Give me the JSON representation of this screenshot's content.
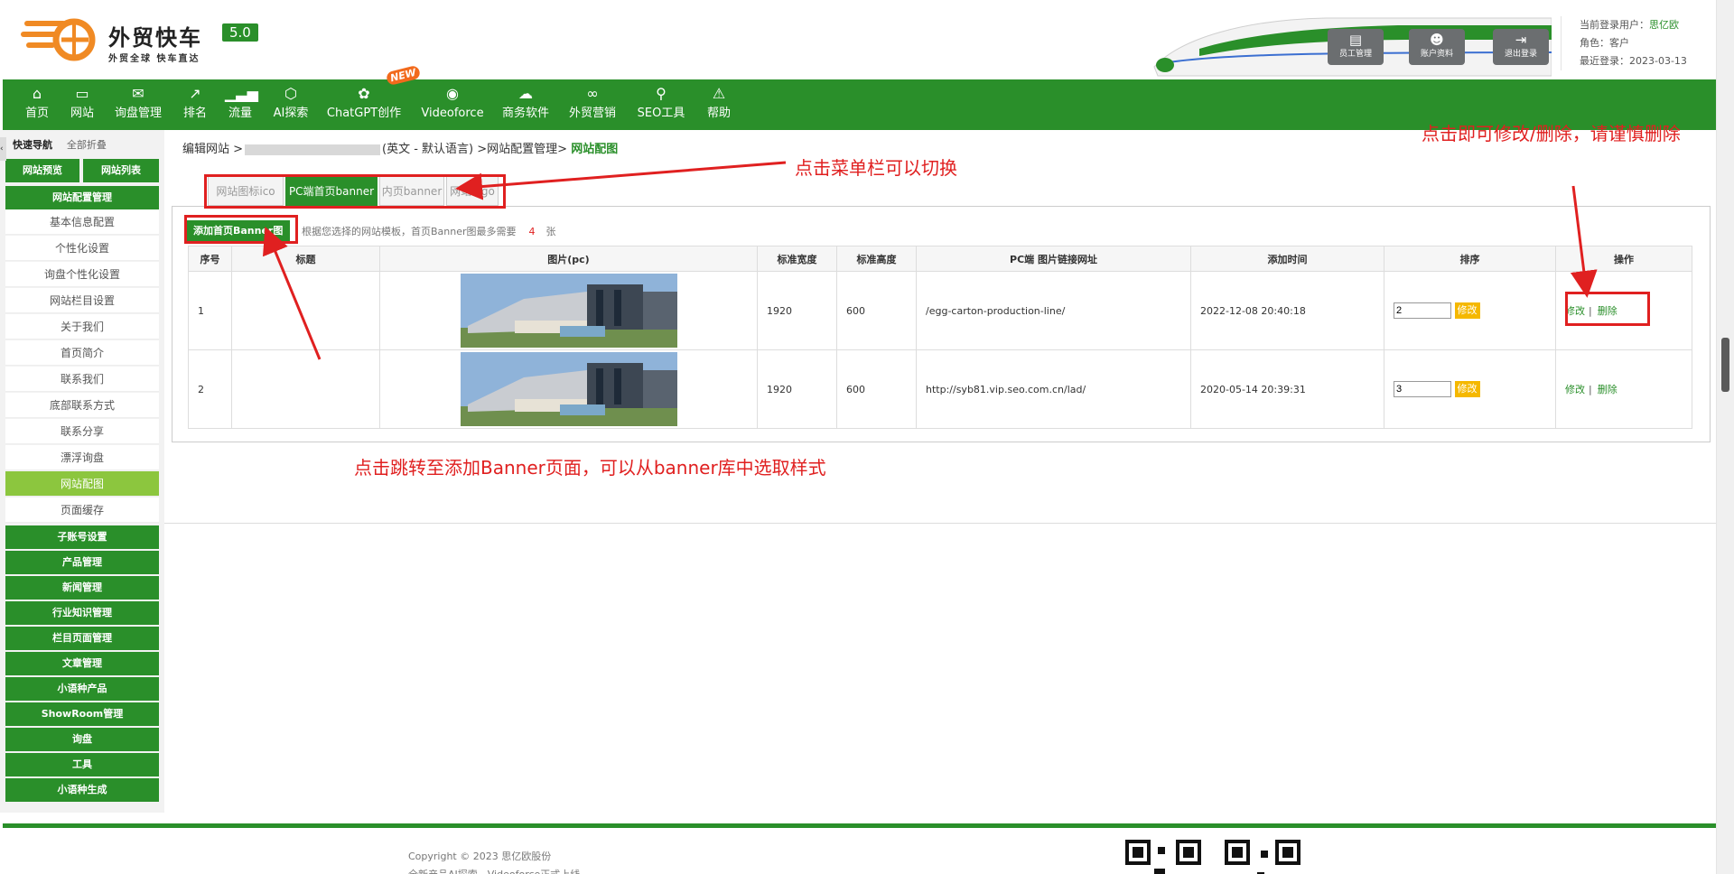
{
  "header": {
    "logo_title": "外贸快车",
    "logo_version": "5.0",
    "logo_slogan": "外贸全球 快车直达",
    "buttons": [
      {
        "label": "员工管理",
        "icon": "id-card-icon"
      },
      {
        "label": "账户资料",
        "icon": "user-icon"
      },
      {
        "label": "退出登录",
        "icon": "logout-icon"
      }
    ],
    "user": {
      "current_user_label": "当前登录用户：",
      "current_user": "思亿欧",
      "role_label": "角色：",
      "role": "客户",
      "last_login_label": "最近登录：",
      "last_login": "2023-03-13"
    }
  },
  "nav": {
    "items": [
      {
        "label": "首页",
        "icon": "home-icon"
      },
      {
        "label": "网站",
        "icon": "monitor-icon"
      },
      {
        "label": "询盘管理",
        "icon": "mail-icon"
      },
      {
        "label": "排名",
        "icon": "ranking-icon"
      },
      {
        "label": "流量",
        "icon": "bar-chart-icon"
      },
      {
        "label": "AI探索",
        "icon": "ai-icon"
      },
      {
        "label": "ChatGPT创作",
        "icon": "chatgpt-icon"
      },
      {
        "label": "Videoforce",
        "icon": "video-icon"
      },
      {
        "label": "商务软件",
        "icon": "cloud-icon"
      },
      {
        "label": "外贸营销",
        "icon": "marketing-icon"
      },
      {
        "label": "SEO工具",
        "icon": "search-icon"
      },
      {
        "label": "帮助",
        "icon": "warning-icon"
      }
    ],
    "new_badge": "NEW"
  },
  "sidebar": {
    "quick_nav": "快速导航",
    "fold_all": "全部折叠",
    "site_preview": "网站预览",
    "site_list": "网站列表",
    "section_title": "网站配置管理",
    "sub_items": [
      "基本信息配置",
      "个性化设置",
      "询盘个性化设置",
      "网站栏目设置",
      "关于我们",
      "首页简介",
      "联系我们",
      "底部联系方式",
      "联系分享",
      "漂浮询盘",
      "网站配图",
      "页面缓存"
    ],
    "active_sub": "网站配图",
    "groups": [
      "子账号设置",
      "产品管理",
      "新闻管理",
      "行业知识管理",
      "栏目页面管理",
      "文章管理",
      "小语种产品",
      "ShowRoom管理",
      "询盘",
      "工具",
      "小语种生成"
    ]
  },
  "breadcrumb": {
    "prefix": "编辑网站 >",
    "middle": "(英文 - 默认语言) >网站配置管理>",
    "current": "网站配图"
  },
  "tabs": [
    {
      "label": "网站图标ico",
      "active": false
    },
    {
      "label": "PC端首页banner",
      "active": true
    },
    {
      "label": "内页banner",
      "active": false
    },
    {
      "label": "网站logo",
      "active": false
    }
  ],
  "toolbar": {
    "add_button": "添加首页Banner图",
    "note_prefix": "根据您选择的网站模板，首页Banner图最多需要",
    "note_count": "4",
    "note_unit": "张"
  },
  "table": {
    "headers": [
      "序号",
      "标题",
      "图片(pc)",
      "标准宽度",
      "标准高度",
      "PC端 图片链接网址",
      "添加时间",
      "排序",
      "操作"
    ],
    "rows": [
      {
        "index": "1",
        "title": "",
        "width": "1920",
        "height": "600",
        "link": "/egg-carton-production-line/",
        "time": "2022-12-08 20:40:18",
        "sort": "2"
      },
      {
        "index": "2",
        "title": "",
        "width": "1920",
        "height": "600",
        "link": "http://syb81.vip.seo.com.cn/lad/",
        "time": "2020-05-14 20:39:31",
        "sort": "3"
      }
    ],
    "sort_button": "修改",
    "edit_link": "修改",
    "delete_link": "删除",
    "separator": "|"
  },
  "annotations": {
    "switch_tip": "点击菜单栏可以切换",
    "edit_tip": "点击即可修改/删除，请谨慎删除",
    "add_tip": "点击跳转至添加Banner页面，可以从banner库中选取样式",
    "color": "#e02020"
  },
  "footer": {
    "copyright": "Copyright © 2023 思亿欧股份",
    "line2": "全新产品AI探索、Videoforce正式上线"
  },
  "colors": {
    "brand_green": "#2a8f2a",
    "active_light_green": "#8cc63e",
    "sort_button_yellow": "#f5b800",
    "logo_orange": "#f08a24"
  }
}
